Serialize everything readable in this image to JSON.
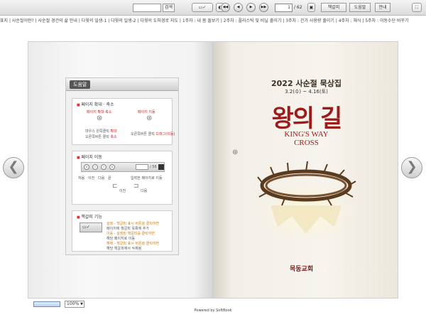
{
  "toolbar": {
    "search_placeholder": "",
    "search_button": "검색",
    "page_current": "1",
    "page_total": "/ 62",
    "bookmark_label": "책갈피",
    "help_label": "도움말",
    "guide_label": "안내"
  },
  "toc": {
    "items": [
      "표지",
      "사순절이란?",
      "사순절 경건의 삶 안내",
      "다윗의 일생-1",
      "다윗의 일생-2",
      "다윗의 도피경로 지도",
      "1주차 : 내 몸 돌보기",
      "2주차 : 플라스틱 및 비닐 줄이기",
      "3주차 : 간가 사용량 줄이기",
      "4주차 : 채식",
      "5주차 : 이동수단 바꾸기"
    ]
  },
  "help": {
    "title": "도움말",
    "section1": {
      "title": "페이지 확대 · 축소",
      "left_label": "페이지 확대·축소",
      "right_label": "페이지 이동",
      "note_left_a": "마우스 왼쪽클릭",
      "note_left_a_red": "확대",
      "note_left_b": "오른쪽버튼 클릭",
      "note_left_b_red": "축소",
      "note_right": "오른쪽버튼 클릭",
      "note_right_red": "드래그(이동)"
    },
    "section2": {
      "title": "페이지 이동",
      "page_sample": "56",
      "labels": [
        "처음",
        "이전",
        "다음",
        "끝",
        "입력한 페이지로 이동"
      ],
      "prev": "이전",
      "next": "다음"
    },
    "section3": {
      "title": "책갈피 기능",
      "lines": [
        "설정 - 책갈피 표시 버튼을 클릭하면",
        "페이지에 책갈피 목록에 추가",
        "이동 - 설정된 책갈피를 클릭하면",
        "해당 페이지로 이동",
        "해제 - 책갈피 표시 버튼을 클릭하면",
        "해당 책갈피에서 삭제됨"
      ]
    }
  },
  "cover": {
    "title": "2022 사순절 묵상집",
    "date": "3.2(수) ~ 4.16(토)",
    "korean_title": "왕의 길",
    "english_line1": "KING'S WAY",
    "english_line2": "CROSS",
    "publisher": "목동교회"
  },
  "bottom": {
    "zoom": "100%",
    "powered": "Powered by SoftBook"
  },
  "colors": {
    "accent_red": "#9e1b1b",
    "toolbar_bg": "#dcdcdc"
  }
}
